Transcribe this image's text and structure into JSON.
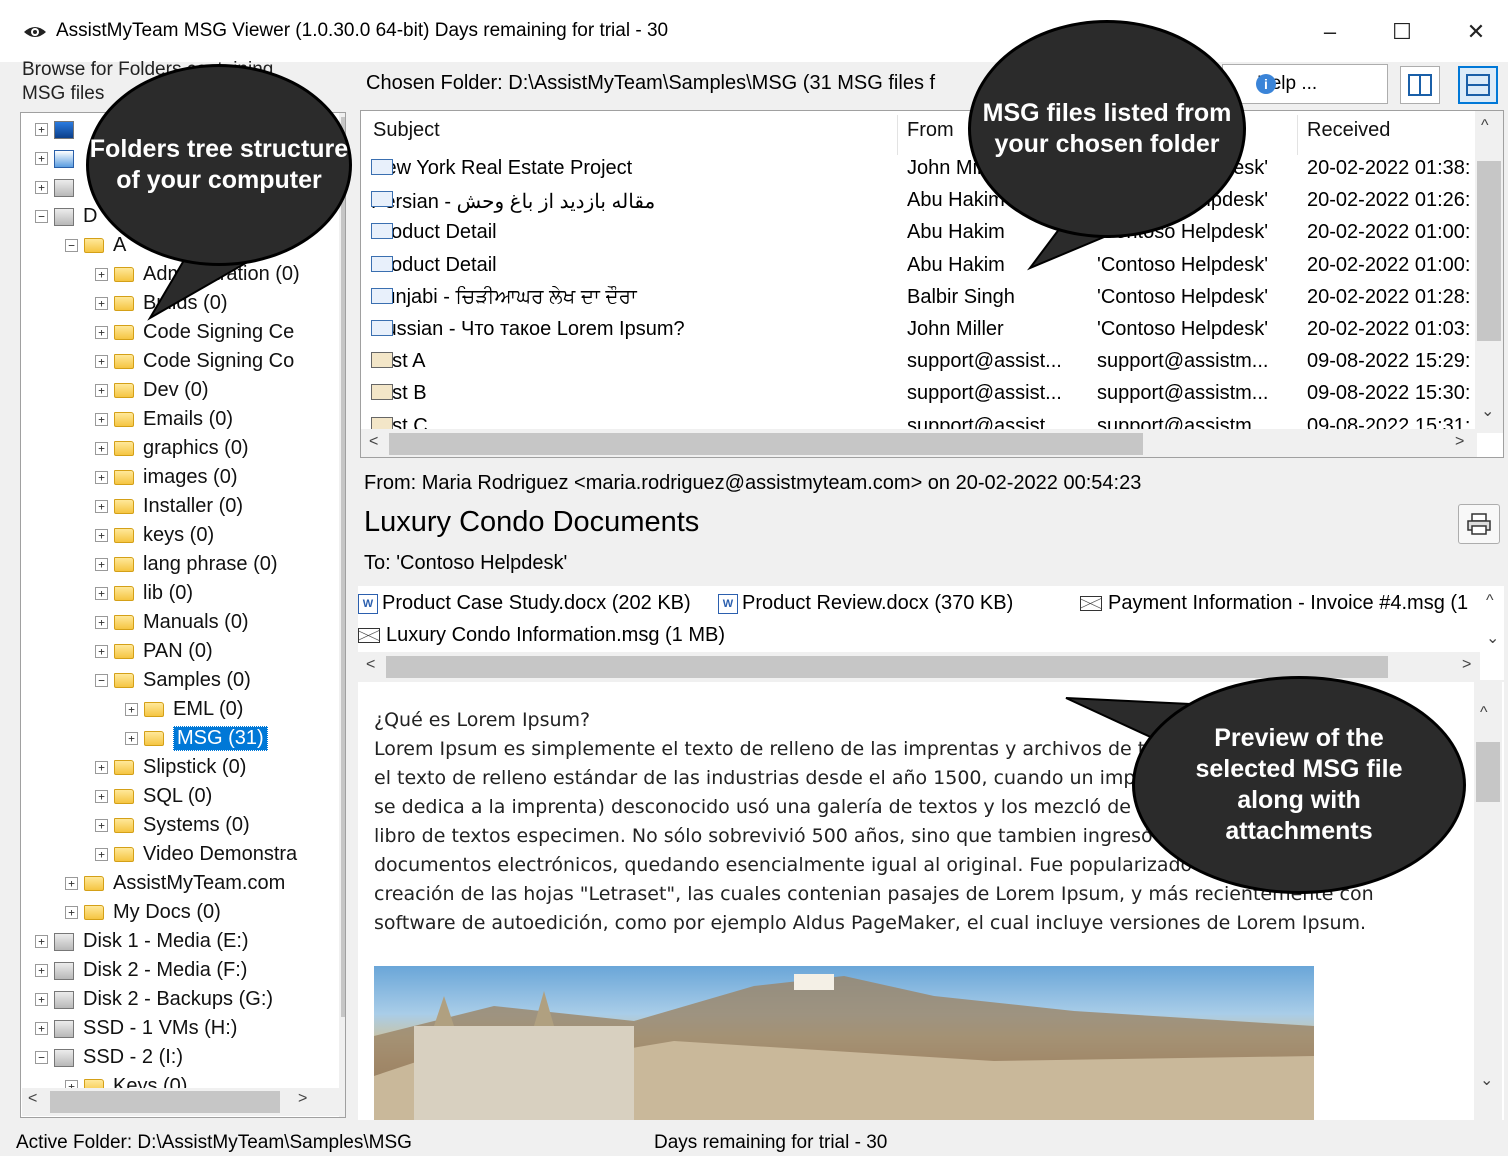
{
  "window": {
    "title": "AssistMyTeam MSG Viewer (1.0.30.0 64-bit)  Days remaining for trial - 30",
    "minimize": "–",
    "maximize": "☐",
    "close": "✕"
  },
  "left_panel": {
    "header_line1": "Browse for Folders containing",
    "header_line2": "MSG files",
    "tree": [
      {
        "label": "",
        "icon": "monitor-icon"
      },
      {
        "label": "",
        "icon": "network-icon"
      },
      {
        "label": "",
        "icon": "disk-icon"
      },
      {
        "label": "D",
        "icon": "disk-icon"
      },
      {
        "label": "A",
        "icon": "folder-icon"
      },
      {
        "label": "Administration (0)",
        "icon": "folder-icon"
      },
      {
        "label": "Builds (0)",
        "icon": "folder-icon"
      },
      {
        "label": "Code Signing Ce",
        "icon": "folder-icon"
      },
      {
        "label": "Code Signing Co",
        "icon": "folder-icon"
      },
      {
        "label": "Dev (0)",
        "icon": "folder-icon"
      },
      {
        "label": "Emails (0)",
        "icon": "folder-icon"
      },
      {
        "label": "graphics (0)",
        "icon": "folder-icon"
      },
      {
        "label": "images (0)",
        "icon": "folder-icon"
      },
      {
        "label": "Installer (0)",
        "icon": "folder-icon"
      },
      {
        "label": "keys (0)",
        "icon": "folder-icon"
      },
      {
        "label": "lang phrase (0)",
        "icon": "folder-icon"
      },
      {
        "label": "lib (0)",
        "icon": "folder-icon"
      },
      {
        "label": "Manuals (0)",
        "icon": "folder-icon"
      },
      {
        "label": "PAN (0)",
        "icon": "folder-icon"
      },
      {
        "label": "Samples (0)",
        "icon": "folder-icon"
      },
      {
        "label": "EML (0)",
        "icon": "folder-icon"
      },
      {
        "label": "MSG (31)",
        "icon": "folder-icon",
        "selected": true
      },
      {
        "label": "Slipstick (0)",
        "icon": "folder-icon"
      },
      {
        "label": "SQL (0)",
        "icon": "folder-icon"
      },
      {
        "label": "Systems (0)",
        "icon": "folder-icon"
      },
      {
        "label": "Video Demonstra",
        "icon": "folder-icon"
      },
      {
        "label": "AssistMyTeam.com",
        "icon": "folder-icon"
      },
      {
        "label": "My Docs (0)",
        "icon": "folder-icon"
      },
      {
        "label": "Disk 1 - Media (E:)",
        "icon": "disk-icon"
      },
      {
        "label": "Disk 2 - Media (F:)",
        "icon": "disk-icon"
      },
      {
        "label": "Disk 2 - Backups (G:)",
        "icon": "disk-icon"
      },
      {
        "label": "SSD - 1 VMs (H:)",
        "icon": "disk-icon"
      },
      {
        "label": "SSD - 2 (I:)",
        "icon": "disk-icon"
      },
      {
        "label": "Keys (0)",
        "icon": "folder-icon"
      }
    ]
  },
  "toolbar": {
    "chosen_folder": "Chosen Folder: D:\\AssistMyTeam\\Samples\\MSG (31 MSG files f",
    "help_label": "Help ...",
    "help_icon": "info-icon"
  },
  "grid": {
    "headers": [
      "Subject",
      "From",
      "To",
      "Received"
    ],
    "rows": [
      {
        "icon": "envelope-icon",
        "subject": "New York Real Estate Project",
        "from": "John Miller",
        "to": "'Contoso Helpdesk'",
        "received": "20-02-2022 01:38:"
      },
      {
        "icon": "envelope-icon",
        "subject": "Persian - مقاله بازدید از باغ وحش",
        "from": "Abu Hakim",
        "to": "'Contoso Helpdesk'",
        "received": "20-02-2022 01:26:"
      },
      {
        "icon": "envelope-icon",
        "subject": "Product Detail",
        "from": "Abu Hakim",
        "to": "'Contoso Helpdesk'",
        "received": "20-02-2022 01:00:"
      },
      {
        "icon": "envelope-icon",
        "subject": "Product Detail",
        "from": "Abu Hakim",
        "to": "'Contoso Helpdesk'",
        "received": "20-02-2022 01:00:"
      },
      {
        "icon": "envelope-icon",
        "subject": "Punjabi - ਚਿੜੀਆਘਰ ਲੇਖ ਦਾ ਦੌਰਾ",
        "from": "Balbir Singh",
        "to": "'Contoso Helpdesk'",
        "received": "20-02-2022 01:28:"
      },
      {
        "icon": "envelope-icon",
        "subject": "Russian - Что такое Lorem Ipsum?",
        "from": "John Miller",
        "to": "'Contoso Helpdesk'",
        "received": "20-02-2022 01:03:"
      },
      {
        "icon": "contact-icon",
        "subject": "Test A",
        "from": "support@assist...",
        "to": "support@assistm...",
        "received": "09-08-2022 15:29:"
      },
      {
        "icon": "calendar-icon",
        "subject": "Test B",
        "from": "support@assist...",
        "to": "support@assistm...",
        "received": "09-08-2022 15:30:"
      },
      {
        "icon": "task-icon",
        "subject": "Test C",
        "from": "support@assist...",
        "to": "support@assistm...",
        "received": "09-08-2022 15:31:"
      }
    ]
  },
  "preview": {
    "from_line": "From: Maria Rodriguez <maria.rodriguez@assistmyteam.com> on 20-02-2022 00:54:23",
    "subject": "Luxury Condo Documents",
    "to_line": "To: 'Contoso Helpdesk'",
    "attachments": [
      {
        "icon": "word-icon",
        "label": "Product Case Study.docx (202 KB)"
      },
      {
        "icon": "word-icon",
        "label": "Product Review.docx (370 KB)"
      },
      {
        "icon": "envelope-icon",
        "label": "Payment Information - Invoice #4.msg (1"
      },
      {
        "icon": "envelope-icon",
        "label": "Luxury Condo Information.msg (1 MB)"
      }
    ],
    "body_lines": [
      "¿Qué es Lorem Ipsum?",
      "Lorem Ipsum es simplemente el texto de relleno de las imprentas y archivos de texto. Lorem Ipsum ha sido",
      "el texto de relleno estándar de las industrias desde el año 1500, cuando un impresor (N. del T. persona que",
      "se dedica a la imprenta) desconocido usó una galería de textos y los mezcló de tal manera que logró hacer un",
      "libro de textos especimen. No sólo sobrevivió 500 años, sino que tambien ingresó como texto de relleno en",
      "documentos electrónicos, quedando esencialmente igual al original. Fue popularizado en los 60s con la",
      "creación de las hojas \"Letraset\", las cuales contenian pasajes de Lorem Ipsum, y más recientemente con",
      "software de autoedición, como por ejemplo Aldus PageMaker, el cual incluye versiones de Lorem Ipsum."
    ]
  },
  "callouts": {
    "tree": "Folders tree structure of your computer",
    "list": "MSG files listed from your chosen folder",
    "preview": "Preview of the selected MSG file along with attachments"
  },
  "status": {
    "active_folder": "Active Folder: D:\\AssistMyTeam\\Samples\\MSG",
    "trial": "Days remaining for trial - 30"
  }
}
